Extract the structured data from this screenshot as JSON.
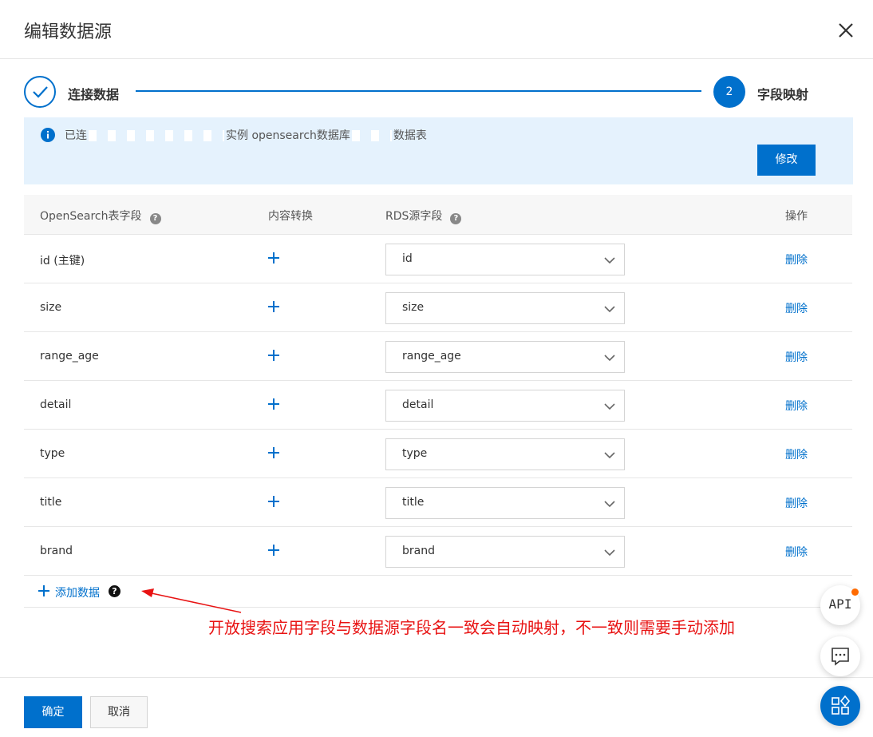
{
  "dialog": {
    "title": "编辑数据源"
  },
  "steps": [
    {
      "label": "连接数据",
      "state": "done"
    },
    {
      "number": "2",
      "label": "字段映射",
      "state": "active"
    }
  ],
  "banner": {
    "text_prefix": "已连",
    "text_instance": "实例 opensearch数据库",
    "text_table": "数据表",
    "modify_label": "修改"
  },
  "table": {
    "headers": {
      "opensearch_field": "OpenSearch表字段",
      "content_transform": "内容转换",
      "rds_field": "RDS源字段",
      "action": "操作"
    },
    "rows": [
      {
        "field": "id (主键)",
        "source": "id",
        "action": "删除"
      },
      {
        "field": "size",
        "source": "size",
        "action": "删除"
      },
      {
        "field": "range_age",
        "source": "range_age",
        "action": "删除"
      },
      {
        "field": "detail",
        "source": "detail",
        "action": "删除"
      },
      {
        "field": "type",
        "source": "type",
        "action": "删除"
      },
      {
        "field": "title",
        "source": "title",
        "action": "删除"
      },
      {
        "field": "brand",
        "source": "brand",
        "action": "删除"
      }
    ],
    "add_label": "添加数据"
  },
  "annotation": {
    "text": "开放搜索应用字段与数据源字段名一致会自动映射，不一致则需要手动添加"
  },
  "footer": {
    "ok_label": "确定",
    "cancel_label": "取消"
  },
  "floating": {
    "api_label": "API"
  },
  "colors": {
    "primary": "#0070cc",
    "banner_bg": "#e5f2fd",
    "annotation": "#e81313",
    "notify_dot": "#ff6a00"
  }
}
